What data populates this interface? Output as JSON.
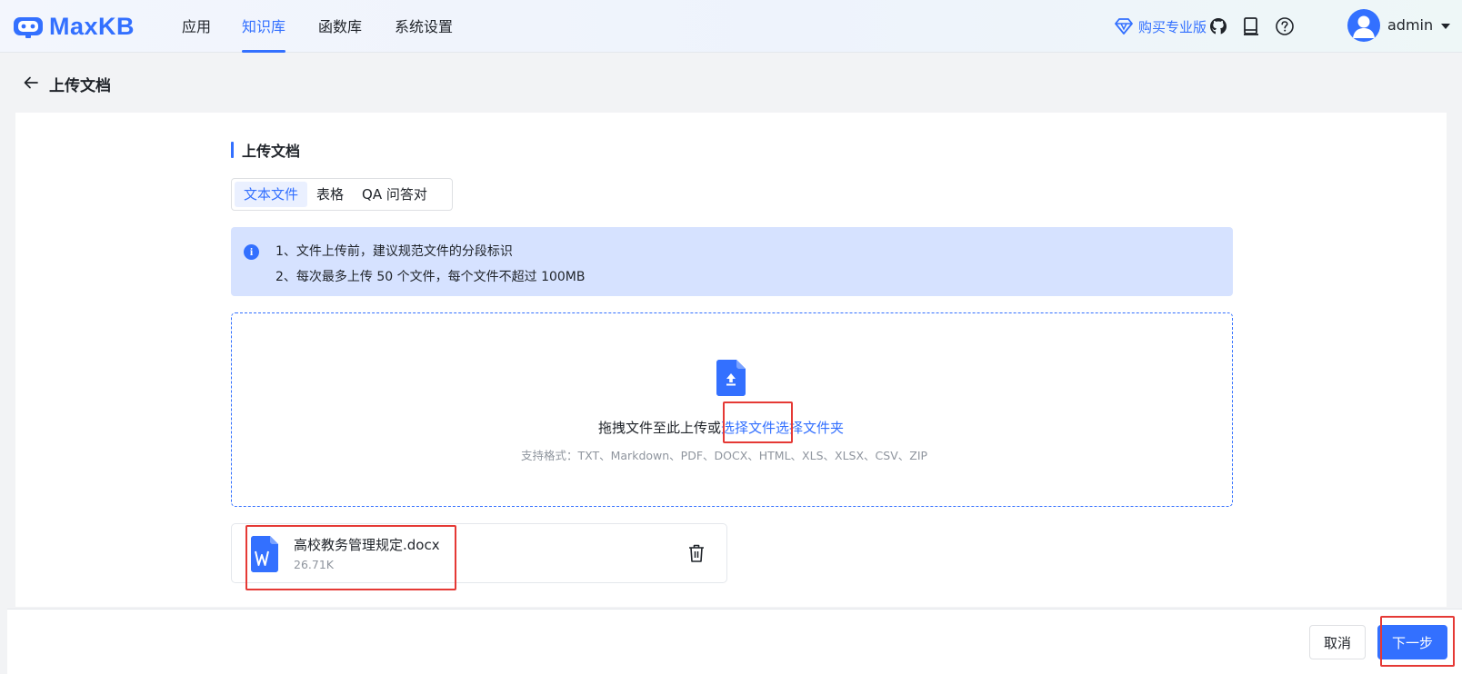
{
  "brand": {
    "name": "MaxKB"
  },
  "nav": {
    "items": [
      {
        "label": "应用"
      },
      {
        "label": "知识库",
        "active": true
      },
      {
        "label": "函数库"
      },
      {
        "label": "系统设置"
      }
    ]
  },
  "header": {
    "buy_pro_label": "购买专业版",
    "icons": [
      "github-icon",
      "document-icon",
      "help-icon"
    ],
    "user": {
      "name": "admin"
    }
  },
  "page": {
    "title": "上传文档",
    "back_icon": "arrow-left-icon"
  },
  "section": {
    "title": "上传文档",
    "tabs": [
      {
        "label": "文本文件",
        "active": true
      },
      {
        "label": "表格"
      },
      {
        "label": "QA 问答对"
      }
    ]
  },
  "notice": {
    "icon": "info-icon",
    "lines": [
      "1、文件上传前，建议规范文件的分段标识",
      "2、每次最多上传 50 个文件，每个文件不超过 100MB"
    ]
  },
  "upload": {
    "prompt": "拖拽文件至此上传或",
    "select_file": "选择文件",
    "select_folder": "选择文件夹",
    "formats": "支持格式：TXT、Markdown、PDF、DOCX、HTML、XLS、XLSX、CSV、ZIP"
  },
  "files": [
    {
      "name": "高校教务管理规定.docx",
      "size": "26.71K",
      "icon": "word-file-icon"
    }
  ],
  "footer": {
    "cancel_label": "取消",
    "next_label": "下一步"
  },
  "colors": {
    "primary": "#3370ff",
    "annotation": "#e53935",
    "notice_bg": "#d6e2ff"
  }
}
